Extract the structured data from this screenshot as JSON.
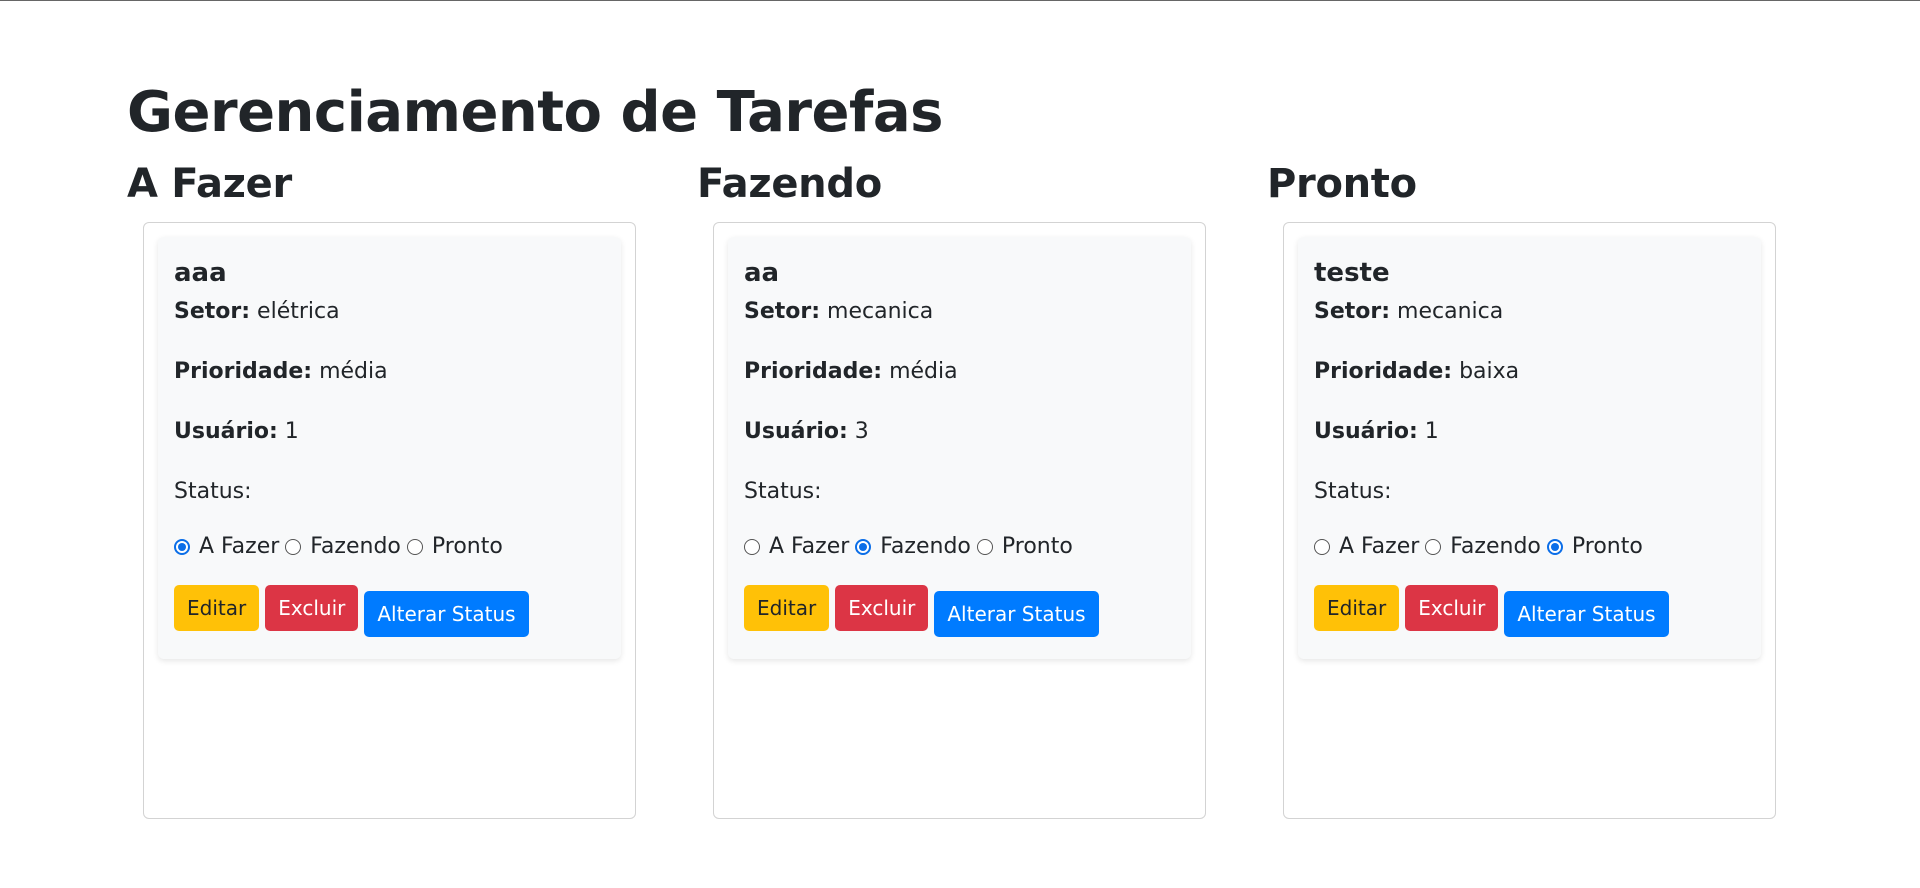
{
  "page": {
    "title": "Gerenciamento de Tarefas"
  },
  "labels": {
    "setor": "Setor:",
    "prioridade": "Prioridade:",
    "usuario": "Usuário:",
    "status": "Status:"
  },
  "status_options": [
    "A Fazer",
    "Fazendo",
    "Pronto"
  ],
  "buttons": {
    "edit": "Editar",
    "delete": "Excluir",
    "change_status": "Alterar Status"
  },
  "colors": {
    "edit": "#ffc107",
    "delete": "#dc3545",
    "change_status": "#007bff",
    "radio_accent": "#0b6ee8"
  },
  "columns": [
    {
      "title": "A Fazer",
      "tasks": [
        {
          "name": "aaa",
          "setor": "elétrica",
          "prioridade": "média",
          "usuario": "1",
          "status": "A Fazer"
        }
      ]
    },
    {
      "title": "Fazendo",
      "tasks": [
        {
          "name": "aa",
          "setor": "mecanica",
          "prioridade": "média",
          "usuario": "3",
          "status": "Fazendo"
        }
      ]
    },
    {
      "title": "Pronto",
      "tasks": [
        {
          "name": "teste",
          "setor": "mecanica",
          "prioridade": "baixa",
          "usuario": "1",
          "status": "Pronto"
        }
      ]
    }
  ]
}
